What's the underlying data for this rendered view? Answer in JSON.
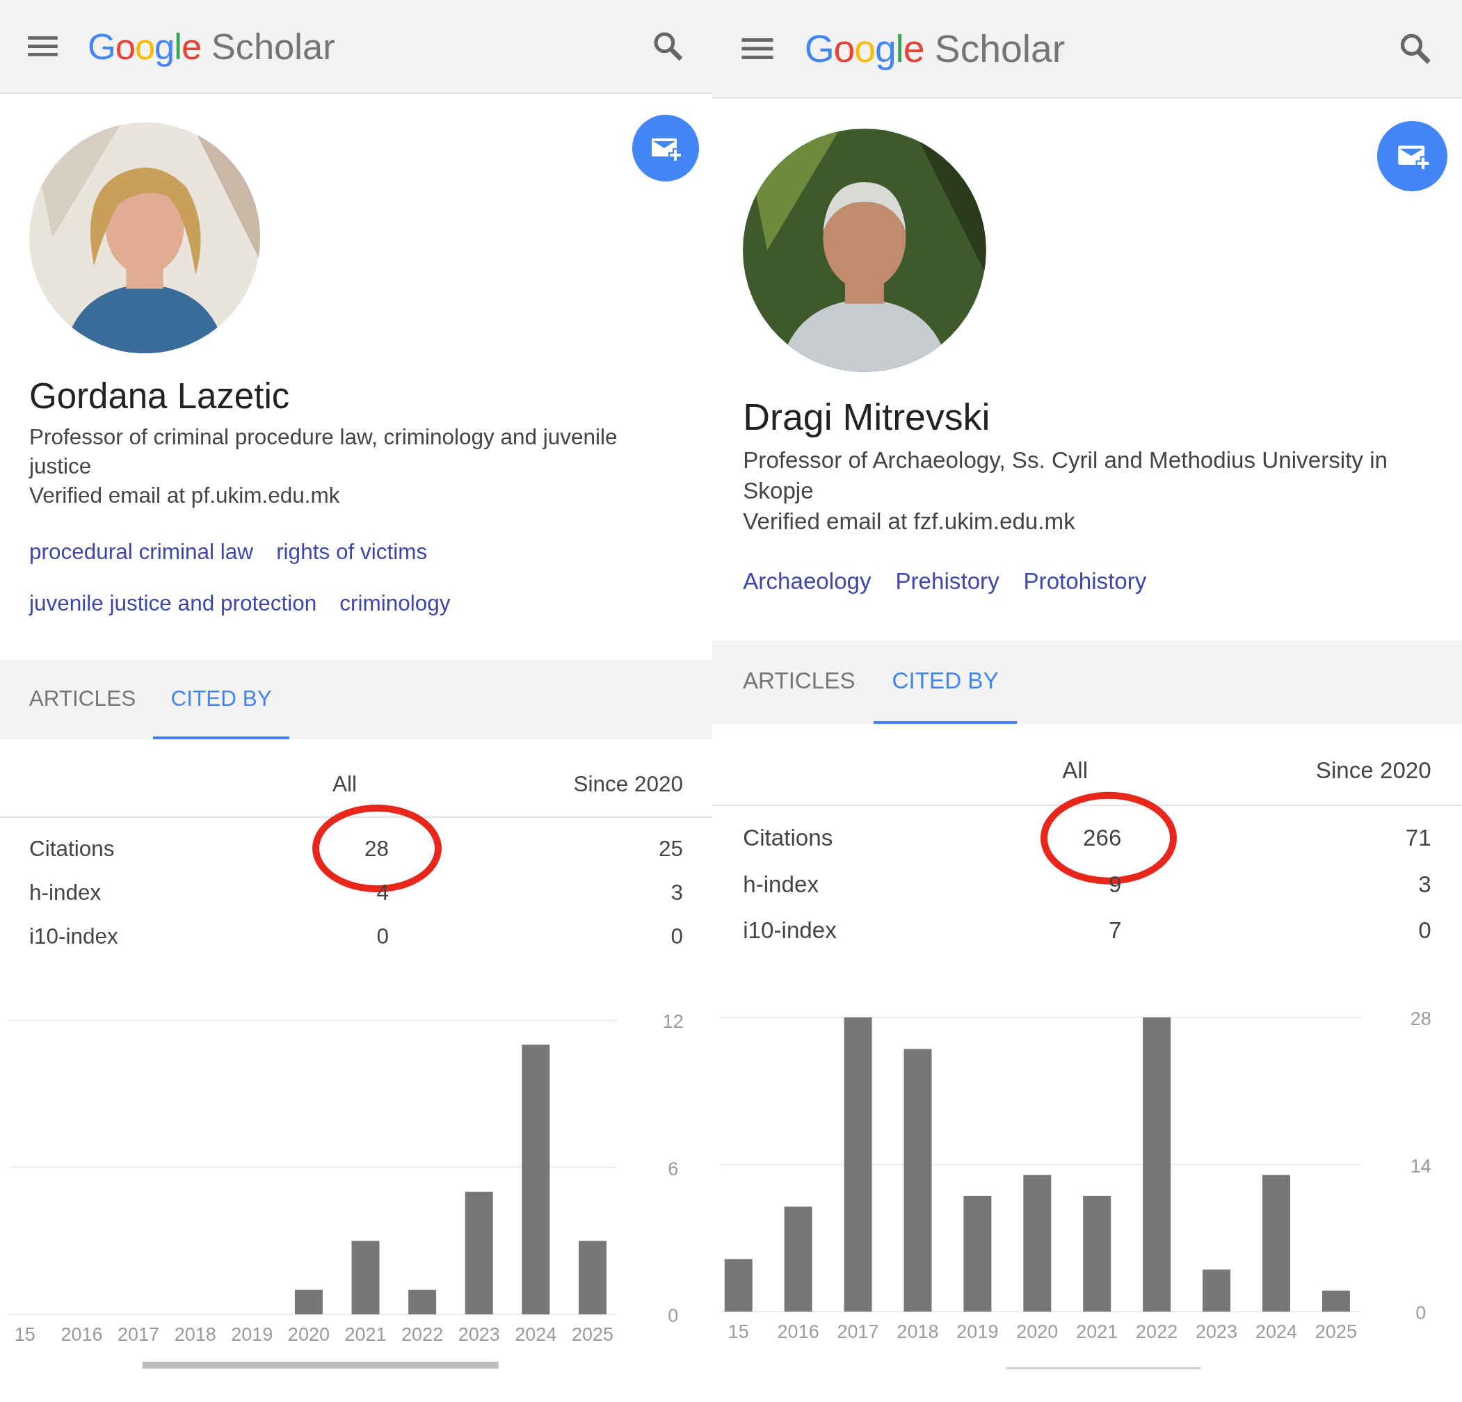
{
  "panels": [
    {
      "header": {
        "logo": {
          "brand": "Google",
          "product": "Scholar"
        }
      },
      "profile": {
        "photo": {
          "kind": "picture"
        },
        "name": "Gordana Lazetic",
        "affiliation": "Professor of criminal procedure law, criminology and juvenile justice",
        "email": "Verified email at pf.ukim.edu.mk",
        "interests": [
          [
            "procedural criminal law",
            "rights of victims"
          ],
          [
            "juvenile justice and protection",
            "criminology"
          ]
        ]
      },
      "tabs": [
        {
          "label": "ARTICLES",
          "selected": false
        },
        {
          "label": "CITED BY",
          "selected": true
        }
      ],
      "stats": {
        "columns": [
          "All",
          "Since 2020"
        ],
        "rows": [
          {
            "label": "Citations",
            "all": "28",
            "since": "25",
            "circled": true
          },
          {
            "label": "h-index",
            "all": "4",
            "since": "3",
            "circled": false
          },
          {
            "label": "i10-index",
            "all": "0",
            "since": "0",
            "circled": false
          }
        ]
      },
      "chart_data": {
        "type": "bar",
        "categories": [
          "15",
          "2016",
          "2017",
          "2018",
          "2019",
          "2020",
          "2021",
          "2022",
          "2023",
          "2024",
          "2025"
        ],
        "values": [
          0,
          0,
          0,
          0,
          0,
          1,
          3,
          1,
          5,
          11,
          3
        ],
        "ylim": [
          0,
          12
        ],
        "yticks": [
          0,
          6,
          12
        ]
      }
    },
    {
      "header": {
        "logo": {
          "brand": "Google",
          "product": "Scholar"
        }
      },
      "profile": {
        "photo": {
          "kind": "picture"
        },
        "name": "Dragi Mitrevski",
        "affiliation": "Professor of Archaeology, Ss. Cyril and Methodius University in Skopje",
        "email": "Verified email at fzf.ukim.edu.mk",
        "interests": [
          [
            "Archaeology",
            "Prehistory",
            "Protohistory"
          ]
        ]
      },
      "tabs": [
        {
          "label": "ARTICLES",
          "selected": false
        },
        {
          "label": "CITED BY",
          "selected": true
        }
      ],
      "stats": {
        "columns": [
          "All",
          "Since 2020"
        ],
        "rows": [
          {
            "label": "Citations",
            "all": "266",
            "since": "71",
            "circled": true
          },
          {
            "label": "h-index",
            "all": "9",
            "since": "3",
            "circled": false
          },
          {
            "label": "i10-index",
            "all": "7",
            "since": "0",
            "circled": false
          }
        ]
      },
      "chart_data": {
        "type": "bar",
        "categories": [
          "15",
          "2016",
          "2017",
          "2018",
          "2019",
          "2020",
          "2021",
          "2022",
          "2023",
          "2024",
          "2025"
        ],
        "values": [
          5,
          10,
          28,
          25,
          11,
          13,
          11,
          28,
          4,
          13,
          2
        ],
        "ylim": [
          0,
          28
        ],
        "yticks": [
          0,
          14,
          28
        ]
      }
    }
  ]
}
